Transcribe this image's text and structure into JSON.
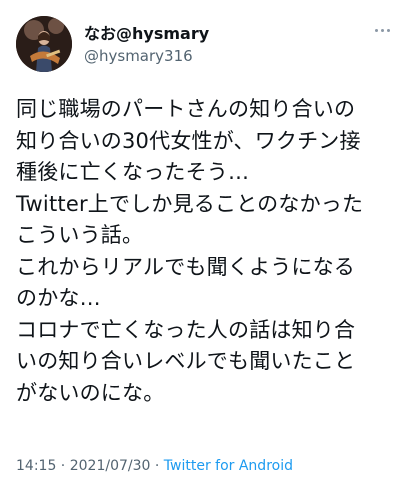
{
  "user": {
    "display_name": "なお@hysmary",
    "handle": "@hysmary316",
    "avatar_icon": "profile-photo-icon"
  },
  "more_icon": "more-dots-icon",
  "tweet": {
    "lines": [
      "同じ職場のパートさんの知り合いの",
      "知り合いの30代女性が、ワクチン接",
      "種後に亡くなったそう…",
      "Twitter上でしか見ることのなかった",
      "こういう話。",
      "これからリアルでも聞くようになる",
      "のかな…",
      "コロナで亡くなった人の話は知り合",
      "いの知り合いレベルでも聞いたこと",
      "がないのにな。"
    ]
  },
  "meta": {
    "time": "14:15",
    "separator1": " · ",
    "date": "2021/07/30",
    "separator2": " · ",
    "source": "Twitter for Android"
  },
  "colors": {
    "text": "#0f1419",
    "secondary": "#536471",
    "link": "#1d9bf0"
  }
}
